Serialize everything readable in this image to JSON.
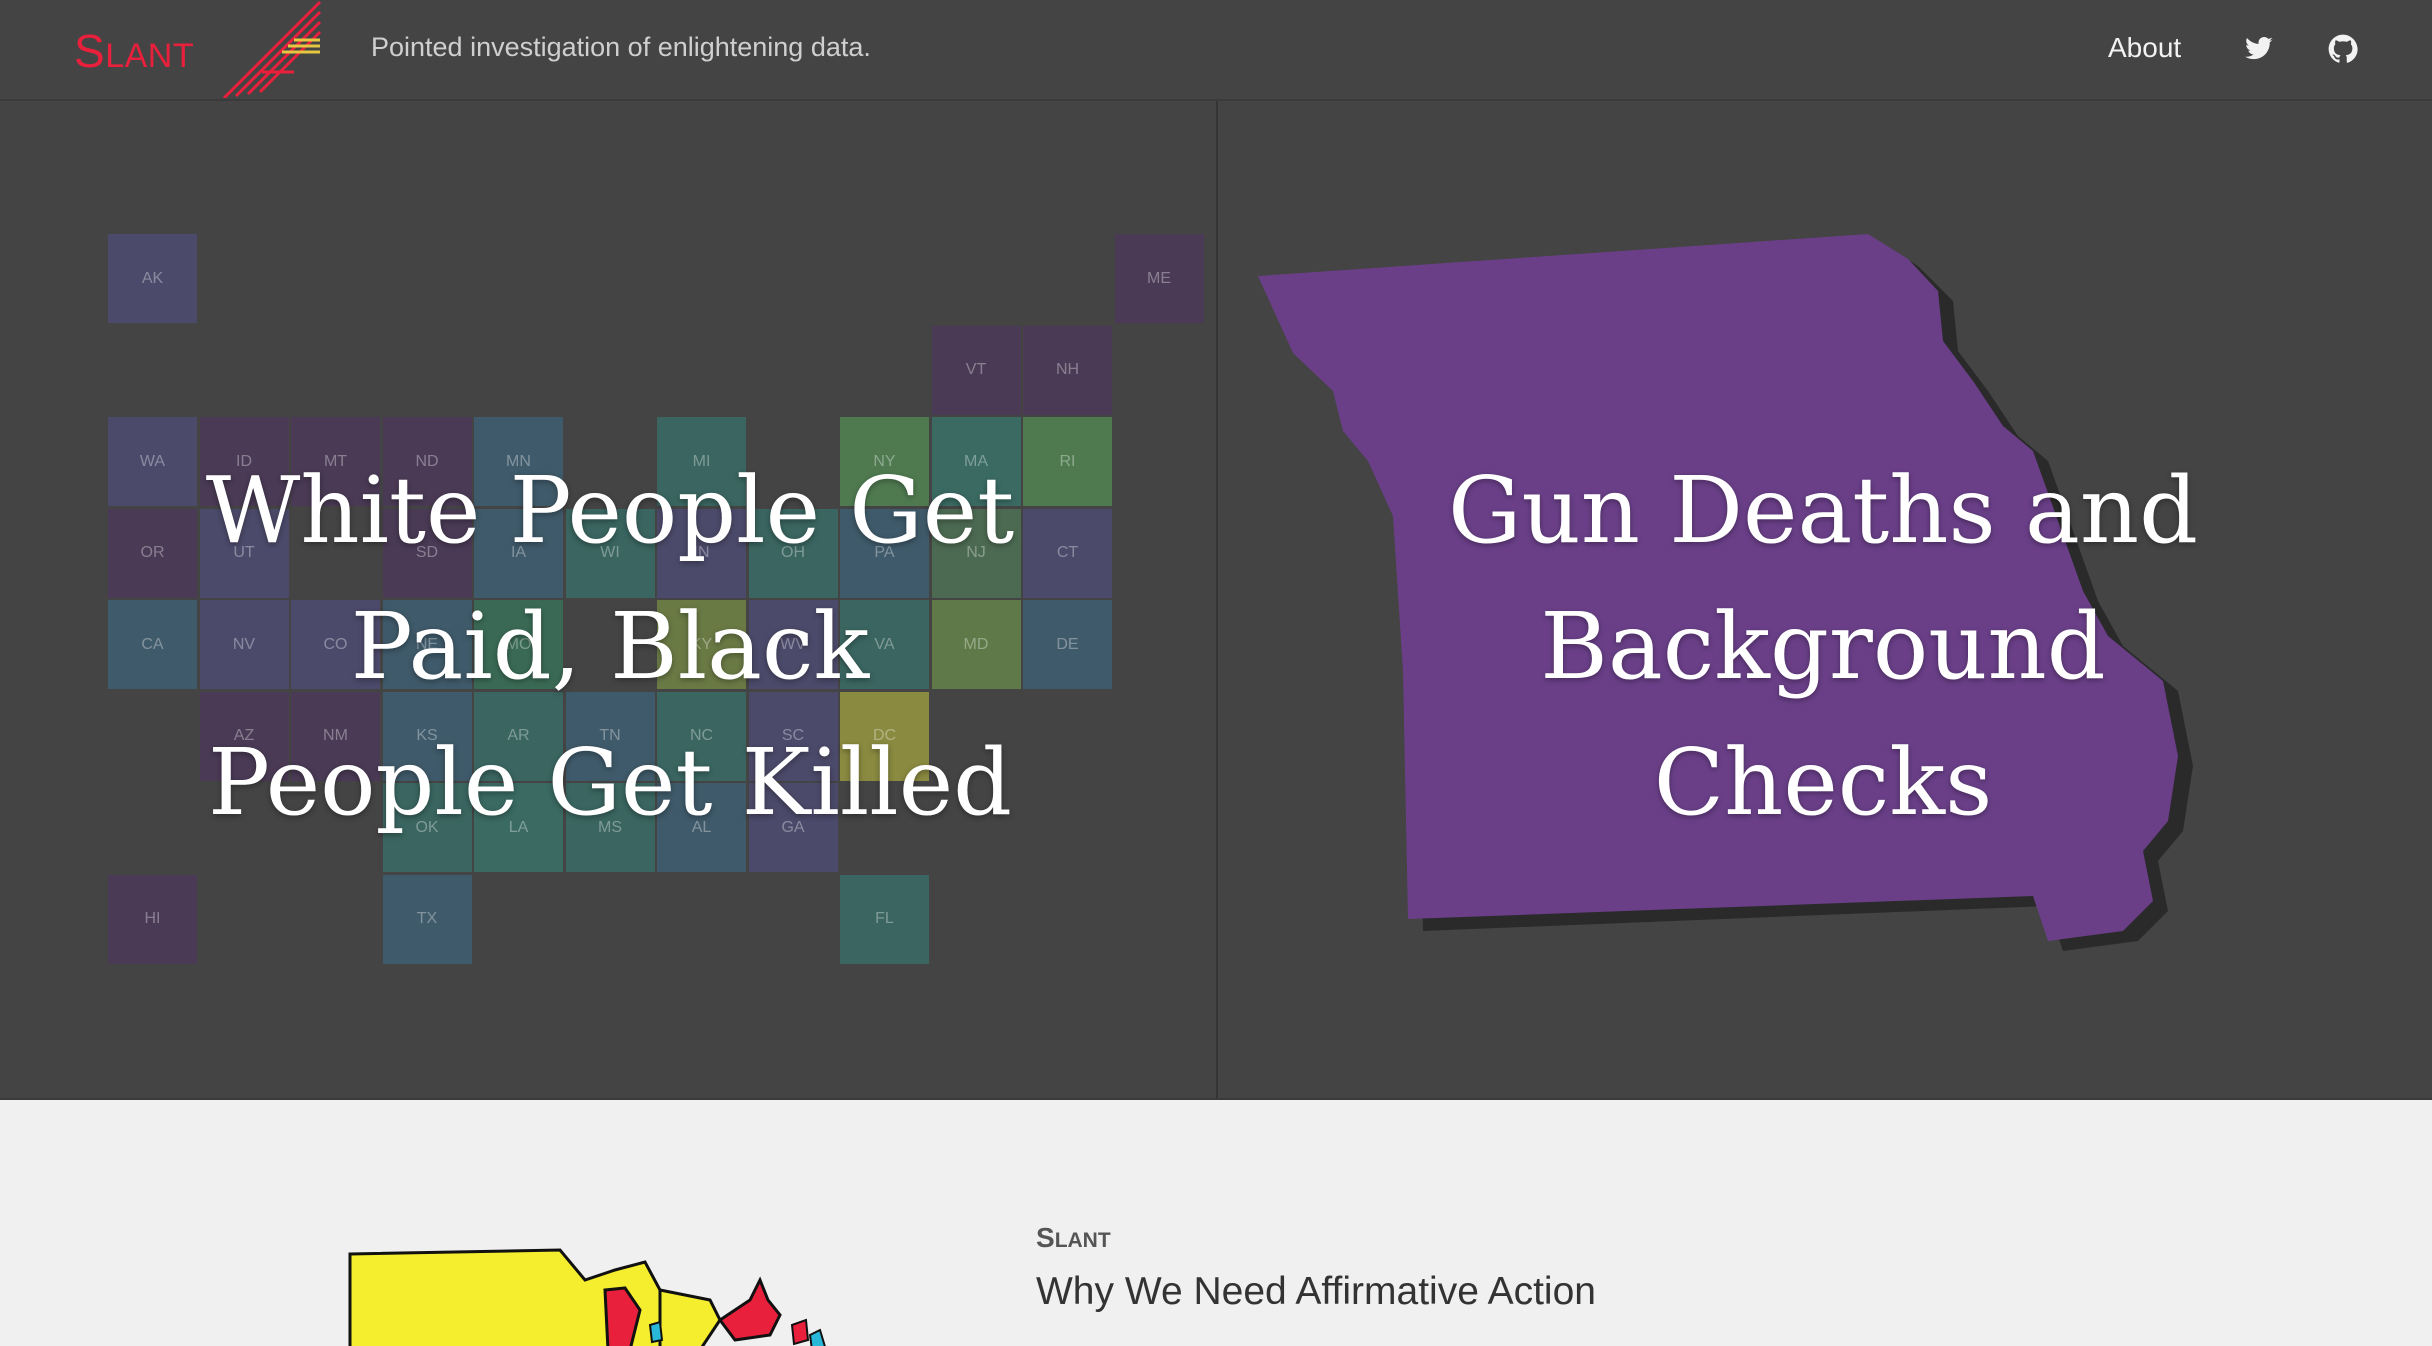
{
  "header": {
    "brand_initial": "S",
    "brand_rest": "LANT",
    "tagline": "Pointed investigation of enlightening data.",
    "nav": {
      "about": "About"
    },
    "icons": [
      "twitter-icon",
      "github-icon"
    ]
  },
  "feature_left": {
    "headline": "White People Get Paid, Black People Get Killed",
    "tiles": [
      {
        "label": "AK",
        "color": "#4c4a6a"
      },
      {
        "label": "ME",
        "color": "#4a3a55"
      },
      {
        "label": "VT",
        "color": "#4a3a55"
      },
      {
        "label": "NH",
        "color": "#4a3a55"
      },
      {
        "label": "WA",
        "color": "#4c4a6a"
      },
      {
        "label": "ID",
        "color": "#4a3a55"
      },
      {
        "label": "MT",
        "color": "#4a3a55"
      },
      {
        "label": "ND",
        "color": "#4a3a55"
      },
      {
        "label": "MN",
        "color": "#3f5a6a"
      },
      {
        "label": "MI",
        "color": "#3a6560"
      },
      {
        "label": "NY",
        "color": "#4f7a50"
      },
      {
        "label": "MA",
        "color": "#3a6a62"
      },
      {
        "label": "RI",
        "color": "#4f7a50"
      },
      {
        "label": "OR",
        "color": "#4a3a55"
      },
      {
        "label": "UT",
        "color": "#4c4a6a"
      },
      {
        "label": "SD",
        "color": "#4a3a55"
      },
      {
        "label": "IA",
        "color": "#3f5a6a"
      },
      {
        "label": "WI",
        "color": "#3a6560"
      },
      {
        "label": "OH",
        "color": "#3a6560"
      },
      {
        "label": "PA",
        "color": "#3f5a6a"
      },
      {
        "label": "NJ",
        "color": "#4c6a52"
      },
      {
        "label": "CT",
        "color": "#4c4a6a"
      },
      {
        "label": "CA",
        "color": "#3f5a6a"
      },
      {
        "label": "NV",
        "color": "#4c4a6a"
      },
      {
        "label": "CO",
        "color": "#4c4a6a"
      },
      {
        "label": "NE",
        "color": "#3f5a6a"
      },
      {
        "label": "MO",
        "color": "#3a6a55"
      },
      {
        "label": "KY",
        "color": "#6a7a45"
      },
      {
        "label": "WV",
        "color": "#4c4a6a"
      },
      {
        "label": "VA",
        "color": "#3a6560"
      },
      {
        "label": "MD",
        "color": "#5f7a48"
      },
      {
        "label": "DE",
        "color": "#3f5a6a"
      },
      {
        "label": "AZ",
        "color": "#4a3a55"
      },
      {
        "label": "NM",
        "color": "#4a3a55"
      },
      {
        "label": "KS",
        "color": "#3f5a6a"
      },
      {
        "label": "AR",
        "color": "#3a6560"
      },
      {
        "label": "TN",
        "color": "#3f5a6a"
      },
      {
        "label": "NC",
        "color": "#3a6560"
      },
      {
        "label": "SC",
        "color": "#4c4a6a"
      },
      {
        "label": "DC",
        "color": "#8a8a40"
      },
      {
        "label": "OK",
        "color": "#3a6560"
      },
      {
        "label": "LA",
        "color": "#3a6a62"
      },
      {
        "label": "MS",
        "color": "#3a6560"
      },
      {
        "label": "AL",
        "color": "#3f5a6a"
      },
      {
        "label": "GA",
        "color": "#4c4a6a"
      },
      {
        "label": "HI",
        "color": "#4a3a55"
      },
      {
        "label": "TX",
        "color": "#3f5a6a"
      },
      {
        "label": "FL",
        "color": "#3a6560"
      },
      {
        "label": "IN",
        "color": "#4c4a6a"
      }
    ]
  },
  "feature_right": {
    "headline": "Gun Deaths and Background Checks",
    "shape_color": "#6a3f88"
  },
  "lower": {
    "kicker_initial": "S",
    "kicker_rest": "LANT",
    "title": "Why We Need Affirmative Action"
  },
  "colors": {
    "brand_red": "#e8203c",
    "panel_bg": "#444444",
    "page_bg": "#f0f0f0"
  }
}
